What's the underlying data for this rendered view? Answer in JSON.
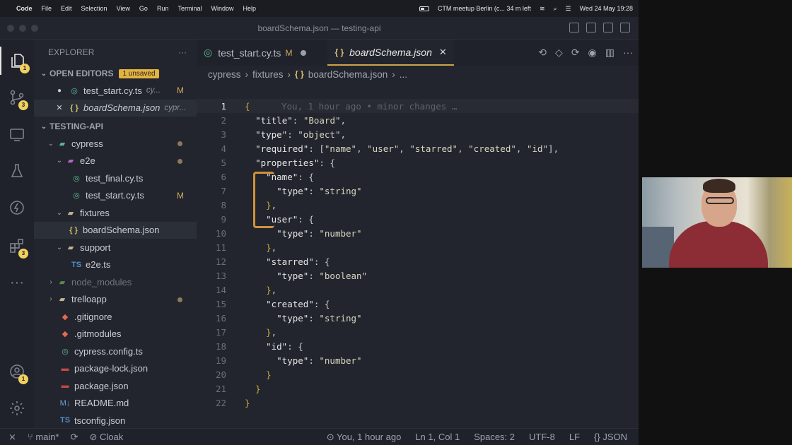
{
  "menubar": {
    "apple": "",
    "items": [
      "Code",
      "File",
      "Edit",
      "Selection",
      "View",
      "Go",
      "Run",
      "Terminal",
      "Window",
      "Help"
    ],
    "event": "CTM meetup Berlin (c... 34 m left",
    "datetime": "Wed 24 May  19:28"
  },
  "window": {
    "title": "boardSchema.json — testing-api"
  },
  "activity_bar": {
    "explorer_badge": "1",
    "scm_badge": "3",
    "extensions_badge": "3",
    "account_badge": "1"
  },
  "explorer": {
    "title": "EXPLORER",
    "more": "···",
    "open_editors": {
      "label": "OPEN EDITORS",
      "unsaved": "1 unsaved",
      "items": [
        {
          "name": "test_start.cy.ts",
          "desc": "cy...",
          "status": "M"
        },
        {
          "name": "boardSchema.json",
          "desc": "cypr..."
        }
      ]
    },
    "project": {
      "label": "TESTING-API",
      "tree": [
        {
          "name": "cypress"
        },
        {
          "name": "e2e"
        },
        {
          "name": "test_final.cy.ts"
        },
        {
          "name": "test_start.cy.ts",
          "status": "M"
        },
        {
          "name": "fixtures"
        },
        {
          "name": "boardSchema.json"
        },
        {
          "name": "support"
        },
        {
          "name": "e2e.ts"
        },
        {
          "name": "node_modules"
        },
        {
          "name": "trelloapp"
        },
        {
          "name": ".gitignore"
        },
        {
          "name": ".gitmodules"
        },
        {
          "name": "cypress.config.ts"
        },
        {
          "name": "package-lock.json"
        },
        {
          "name": "package.json"
        },
        {
          "name": "README.md"
        },
        {
          "name": "tsconfig.json"
        }
      ]
    }
  },
  "tabs": [
    {
      "name": "test_start.cy.ts",
      "status": "M"
    },
    {
      "name": "boardSchema.json"
    }
  ],
  "breadcrumb": [
    "cypress",
    "fixtures",
    "boardSchema.json",
    "..."
  ],
  "code": {
    "blame": "You, 1 hour ago • minor changes …",
    "lines": [
      "{",
      "  \"title\": \"Board\",",
      "  \"type\": \"object\",",
      "  \"required\": [\"name\", \"user\", \"starred\", \"created\", \"id\"],",
      "  \"properties\": {",
      "    \"name\": {",
      "      \"type\": \"string\"",
      "    },",
      "    \"user\": {",
      "      \"type\": \"number\"",
      "    },",
      "    \"starred\": {",
      "      \"type\": \"boolean\"",
      "    },",
      "    \"created\": {",
      "      \"type\": \"string\"",
      "    },",
      "    \"id\": {",
      "      \"type\": \"number\"",
      "    }",
      "  }",
      "}"
    ]
  },
  "statusbar": {
    "branch": "main*",
    "cloak": "Cloak",
    "blame": "You, 1 hour ago",
    "position": "Ln 1, Col 1",
    "spaces": "Spaces: 2",
    "encoding": "UTF-8",
    "eol": "LF",
    "language": "JSON"
  },
  "colors": {
    "accent": "#c9a646",
    "badge": "#f0d05f",
    "modified": "#d1a85c"
  }
}
